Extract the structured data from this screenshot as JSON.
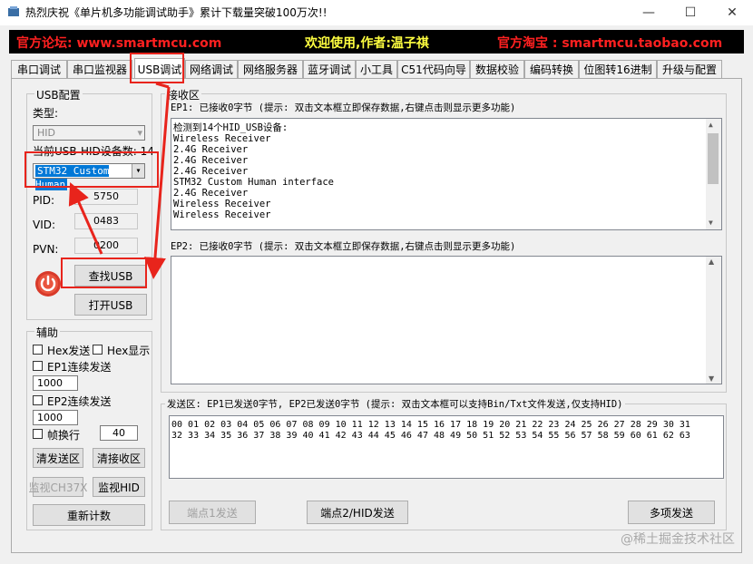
{
  "window": {
    "title": "热烈庆祝《单片机多功能调试助手》累计下载量突破100万次!!",
    "minimize": "—",
    "maximize": "☐",
    "close": "✕"
  },
  "banner": {
    "forum": "官方论坛: www.smartmcu.com",
    "welcome": "欢迎使用,作者:温子祺",
    "shop": "官方淘宝 : smartmcu.taobao.com"
  },
  "tabs": [
    "串口调试",
    "串口监视器",
    "USB调试",
    "网络调试",
    "网络服务器",
    "蓝牙调试",
    "小工具",
    "C51代码向导",
    "数据校验",
    "编码转换",
    "位图转16进制",
    "升级与配置"
  ],
  "usb_config": {
    "group_label": "USB配置",
    "type_label": "类型:",
    "type_value": "HID",
    "device_count_label": "当前USB-HID设备数: 14",
    "device_selected": "STM32 Custom Human",
    "pid_label": "PID:",
    "pid_value": "5750",
    "vid_label": "VID:",
    "vid_value": "0483",
    "pvn_label": "PVN:",
    "pvn_value": "0200",
    "find_button": "查找USB",
    "open_button": "打开USB"
  },
  "assist": {
    "group_label": "辅助",
    "hex_send": "Hex发送",
    "hex_display": "Hex显示",
    "ep1_continuous": "EP1连续发送",
    "ep1_interval": "1000",
    "ep2_continuous": "EP2连续发送",
    "ep2_interval": "1000",
    "frame_newline": "帧换行",
    "frame_value": "40",
    "clear_send": "清发送区",
    "clear_recv": "清接收区",
    "monitor_ch37x": "监视CH37X",
    "monitor_hid": "监视HID",
    "recount": "重新计数"
  },
  "receive": {
    "group_label": "接收区",
    "ep1_status": "EP1: 已接收0字节 (提示: 双击文本框立即保存数据,右键点击则显示更多功能)",
    "ep1_lines": [
      "检测到14个HID_USB设备:",
      "Wireless Receiver",
      "2.4G Receiver",
      "2.4G Receiver",
      "2.4G Receiver",
      "STM32 Custom Human interface",
      "2.4G Receiver",
      "Wireless Receiver",
      "Wireless Receiver"
    ],
    "ep2_status": "EP2: 已接收0字节 (提示: 双击文本框立即保存数据,右键点击则显示更多功能)"
  },
  "send": {
    "group_label": "发送区: EP1已发送0字节, EP2已发送0字节 (提示: 双击文本框可以支持Bin/Txt文件发送,仅支持HID)",
    "line1": "00 01 02 03 04 05 06 07 08 09 10 11 12 13 14 15 16 17 18 19 20 21 22 23 24 25 26 27 28 29 30 31",
    "line2": "32 33 34 35 36 37 38 39 40 41 42 43 44 45 46 47 48 49 50 51 52 53 54 55 56 57 58 59 60 61 62 63",
    "ep1_send": "端点1发送",
    "ep2_send": "端点2/HID发送",
    "multi_send": "多项发送"
  },
  "watermark": "@稀土掘金技术社区",
  "colors": {
    "annotation_red": "#e8241c",
    "banner_red": "#ff2020",
    "banner_yellow": "#ffff40"
  },
  "icons": {
    "power": "power-icon",
    "app": "app-icon"
  }
}
